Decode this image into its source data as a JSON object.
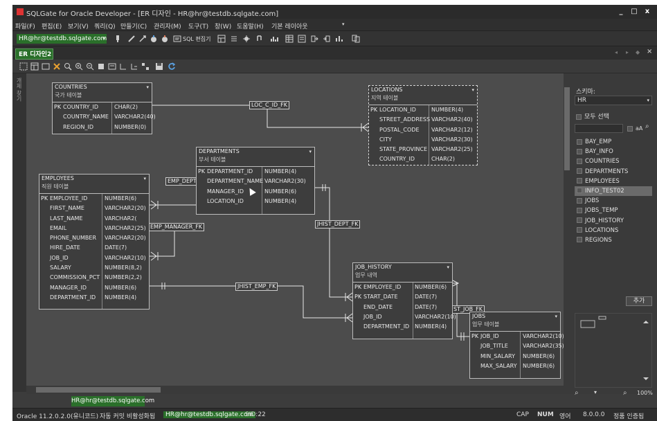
{
  "window": {
    "title": "SQLGate for Oracle Developer - [ER 디자인 - HR@hr@testdb.sqlgate.com]",
    "controls": [
      "_",
      "□",
      "x"
    ]
  },
  "menu": [
    "파일(F)",
    "편집(E)",
    "보기(V)",
    "쿼리(Q)",
    "만들기(C)",
    "관리자(M)",
    "도구(T)",
    "창(W)",
    "도움말(H)",
    "기본 레이아웃"
  ],
  "connection": {
    "combo": "HR@hr@testdb.sqlgate.com",
    "sql_editor_label": "SQL 편집기"
  },
  "doc_tab": "ER 디자인2",
  "left_strip_label": "개체 찾기",
  "entities": {
    "countries": {
      "name": "COUNTRIES",
      "kor": "국가 테이블",
      "rows": [
        {
          "pk": "PK",
          "col": "COUNTRY_ID",
          "type": "CHAR(2)"
        },
        {
          "pk": "",
          "col": "COUNTRY_NAME",
          "type": "VARCHAR2(40)"
        },
        {
          "pk": "",
          "col": "REGION_ID",
          "type": "NUMBER(0)"
        }
      ]
    },
    "locations": {
      "name": "LOCATIONS",
      "kor": "지역 테이블",
      "rows": [
        {
          "pk": "PK",
          "col": "LOCATION_ID",
          "type": "NUMBER(4)"
        },
        {
          "pk": "",
          "col": "STREET_ADDRESS",
          "type": "VARCHAR2(40)"
        },
        {
          "pk": "",
          "col": "POSTAL_CODE",
          "type": "VARCHAR2(12)"
        },
        {
          "pk": "",
          "col": "CITY",
          "type": "VARCHAR2(30)"
        },
        {
          "pk": "",
          "col": "STATE_PROVINCE",
          "type": "VARCHAR2(25)"
        },
        {
          "pk": "",
          "col": "COUNTRY_ID",
          "type": "CHAR(2)"
        }
      ]
    },
    "departments": {
      "name": "DEPARTMENTS",
      "kor": "부서 테이블",
      "rows": [
        {
          "pk": "PK",
          "col": "DEPARTMENT_ID",
          "type": "NUMBER(4)"
        },
        {
          "pk": "",
          "col": "DEPARTMENT_NAME",
          "type": "VARCHAR2(30)"
        },
        {
          "pk": "",
          "col": "MANAGER_ID",
          "type": "NUMBER(6)"
        },
        {
          "pk": "",
          "col": "LOCATION_ID",
          "type": "NUMBER(4)"
        }
      ]
    },
    "employees": {
      "name": "EMPLOYEES",
      "kor": "직원 테이블",
      "rows": [
        {
          "pk": "PK",
          "col": "EMPLOYEE_ID",
          "type": "NUMBER(6)"
        },
        {
          "pk": "",
          "col": "FIRST_NAME",
          "type": "VARCHAR2(20)"
        },
        {
          "pk": "",
          "col": "LAST_NAME",
          "type": "VARCHAR2("
        },
        {
          "pk": "",
          "col": "EMAIL",
          "type": "VARCHAR2(25)"
        },
        {
          "pk": "",
          "col": "PHONE_NUMBER",
          "type": "VARCHAR2(20)"
        },
        {
          "pk": "",
          "col": "HIRE_DATE",
          "type": "DATE(7)"
        },
        {
          "pk": "",
          "col": "JOB_ID",
          "type": "VARCHAR2(10)"
        },
        {
          "pk": "",
          "col": "SALARY",
          "type": "NUMBER(8,2)"
        },
        {
          "pk": "",
          "col": "COMMISSION_PCT",
          "type": "NUMBER(2,2)"
        },
        {
          "pk": "",
          "col": "MANAGER_ID",
          "type": "NUMBER(6)"
        },
        {
          "pk": "",
          "col": "DEPARTMENT_ID",
          "type": "NUMBER(4)"
        }
      ]
    },
    "job_history": {
      "name": "JOB_HISTORY",
      "kor": "업무 내역",
      "rows": [
        {
          "pk": "PK",
          "col": "EMPLOYEE_ID",
          "type": "NUMBER(6)"
        },
        {
          "pk": "PK",
          "col": "START_DATE",
          "type": "DATE(7)"
        },
        {
          "pk": "",
          "col": "END_DATE",
          "type": "DATE(7)"
        },
        {
          "pk": "",
          "col": "JOB_ID",
          "type": "VARCHAR2(10)"
        },
        {
          "pk": "",
          "col": "DEPARTMENT_ID",
          "type": "NUMBER(4)"
        }
      ]
    },
    "jobs": {
      "name": "JOBS",
      "kor": "업무 테이블",
      "rows": [
        {
          "pk": "PK",
          "col": "JOB_ID",
          "type": "VARCHAR2(10)"
        },
        {
          "pk": "",
          "col": "JOB_TITLE",
          "type": "VARCHAR2(35)"
        },
        {
          "pk": "",
          "col": "MIN_SALARY",
          "type": "NUMBER(6)"
        },
        {
          "pk": "",
          "col": "MAX_SALARY",
          "type": "NUMBER(6)"
        }
      ]
    }
  },
  "fk_labels": {
    "loc_c_id": "LOC_C_ID_FK",
    "emp_dept": "EMP_DEPT_FK",
    "emp_manager": "EMP_MANAGER_FK",
    "jhist_dept": "JHIST_DEPT_FK",
    "jhist_emp": "JHIST_EMP_FK",
    "jhist_job": "ST_JOB_FK"
  },
  "right_panel": {
    "schema_label": "스키마:",
    "schema_value": "HR",
    "select_all": "모두 선택",
    "filter_aa": "aA",
    "tables": [
      "BAY_EMP",
      "BAY_INFO",
      "COUNTRIES",
      "DEPARTMENTS",
      "EMPLOYEES",
      "INFO_TEST02",
      "JOBS",
      "JOBS_TEMP",
      "JOB_HISTORY",
      "LOCATIONS",
      "REGIONS"
    ],
    "highlighted": "INFO_TEST02",
    "add_button": "추가",
    "zoom": "100%"
  },
  "bottom_tab": "HR@hr@testdb.sqlgate.com",
  "status": {
    "oracle": "Oracle 11.2.0.2.0(유니코드)",
    "autocommit": "자동 커밋 비활성화됨",
    "conn": "HR@hr@testdb.sqlgate.com",
    "sid": "SID:22",
    "cap": "CAP",
    "num": "NUM",
    "lang": "영어",
    "version": "8.0.0.0",
    "license": "정품 인증됨"
  },
  "colors": {
    "accent_green": "#2a6f2a",
    "canvas": "#4c4c4c",
    "window_bg": "#3c3c3c"
  }
}
